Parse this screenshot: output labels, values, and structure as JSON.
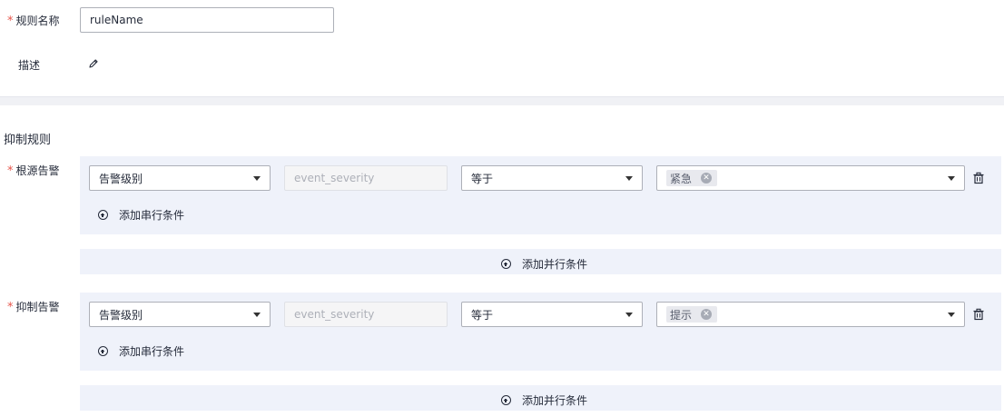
{
  "form": {
    "rule_name": {
      "required_mark": "*",
      "label": "规则名称",
      "value": "ruleName"
    },
    "description": {
      "label": "描述",
      "edit_icon": "pencil-icon"
    }
  },
  "suppression": {
    "section_title": "抑制规则",
    "blocks": [
      {
        "required_mark": "*",
        "label": "根源告警",
        "field_select": "告警级别",
        "field_key": "event_severity",
        "operator_select": "等于",
        "value_tags": [
          {
            "text": "紧急"
          }
        ],
        "add_serial": "添加串行条件",
        "add_parallel": "添加并行条件"
      },
      {
        "required_mark": "*",
        "label": "抑制告警",
        "field_select": "告警级别",
        "field_key": "event_severity",
        "operator_select": "等于",
        "value_tags": [
          {
            "text": "提示"
          }
        ],
        "add_serial": "添加串行条件",
        "add_parallel": "添加并行条件"
      }
    ]
  },
  "colors": {
    "required": "#e6554a",
    "panel_bg": "#eff2fa",
    "border": "#adb0b8",
    "text": "#252b3a"
  }
}
